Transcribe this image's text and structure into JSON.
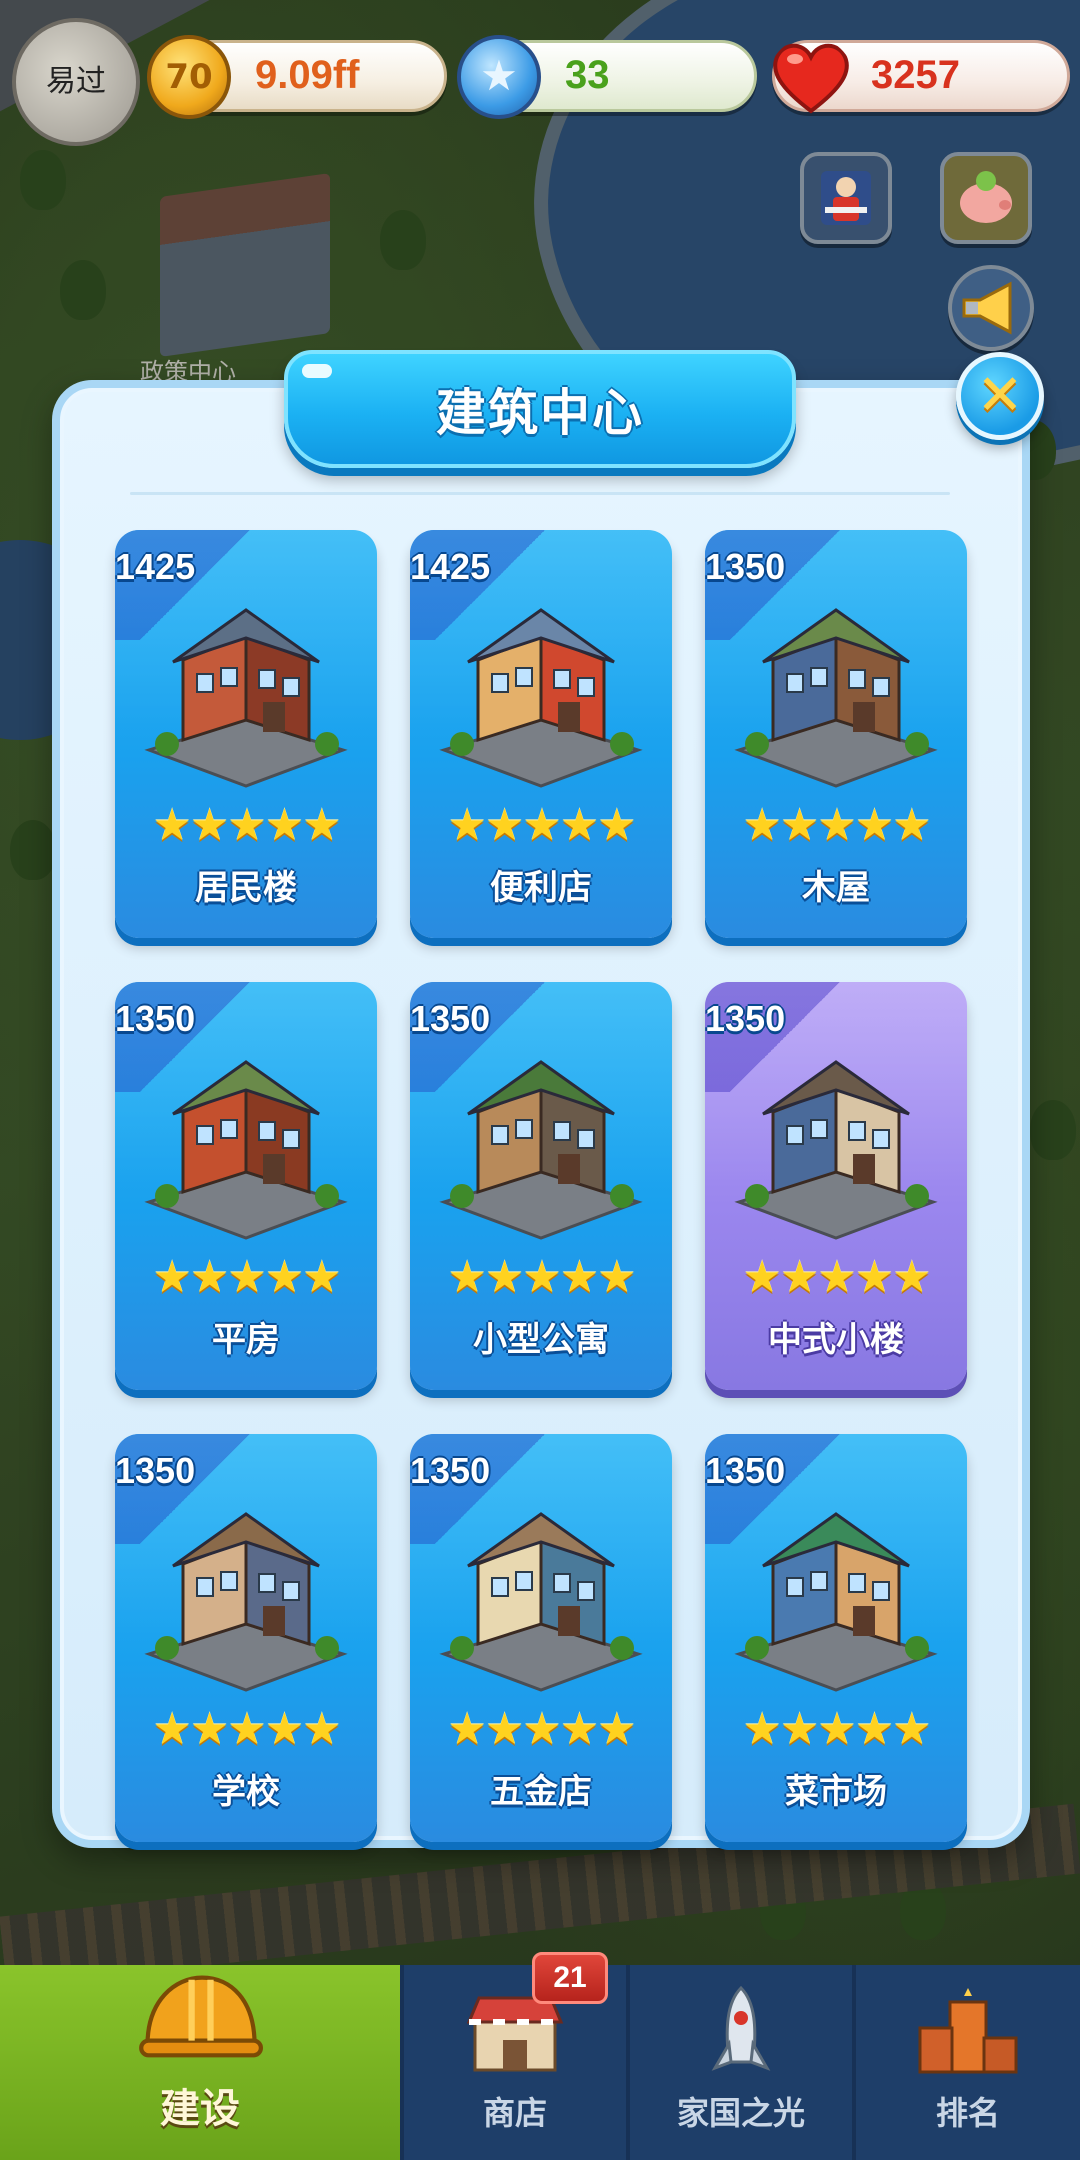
{
  "player": {
    "avatar_text": "易过"
  },
  "resources": {
    "coin": {
      "icon": "coin-icon",
      "glyph": "70",
      "value": "9.09ff"
    },
    "gem": {
      "icon": "star-gem-icon",
      "glyph": "★",
      "value": "33"
    },
    "heart": {
      "icon": "heart-icon",
      "value": "3257"
    }
  },
  "background": {
    "building_label": "政策中心"
  },
  "modal": {
    "title": "建筑中心",
    "close_glyph": "✕"
  },
  "buildings": [
    {
      "cost": "1425",
      "name": "居民楼",
      "stars": 5,
      "color": "blue"
    },
    {
      "cost": "1425",
      "name": "便利店",
      "stars": 5,
      "color": "blue"
    },
    {
      "cost": "1350",
      "name": "木屋",
      "stars": 5,
      "color": "blue"
    },
    {
      "cost": "1350",
      "name": "平房",
      "stars": 5,
      "color": "blue"
    },
    {
      "cost": "1350",
      "name": "小型公寓",
      "stars": 5,
      "color": "blue"
    },
    {
      "cost": "1350",
      "name": "中式小楼",
      "stars": 5,
      "color": "purple"
    },
    {
      "cost": "1350",
      "name": "学校",
      "stars": 5,
      "color": "blue"
    },
    {
      "cost": "1350",
      "name": "五金店",
      "stars": 5,
      "color": "blue"
    },
    {
      "cost": "1350",
      "name": "菜市场",
      "stars": 5,
      "color": "blue"
    }
  ],
  "star_glyphs": "★★★★★",
  "bottom_nav": {
    "build": "建设",
    "shop": "商店",
    "shop_badge": "21",
    "glory": "家国之光",
    "rank": "排名"
  },
  "colors": {
    "card_blue": "#1aa1ee",
    "card_purple": "#9a86ee",
    "nav_active": "#7cb624",
    "nav_bg": "#1e3e69",
    "title_bar": "#1bb1f3"
  }
}
